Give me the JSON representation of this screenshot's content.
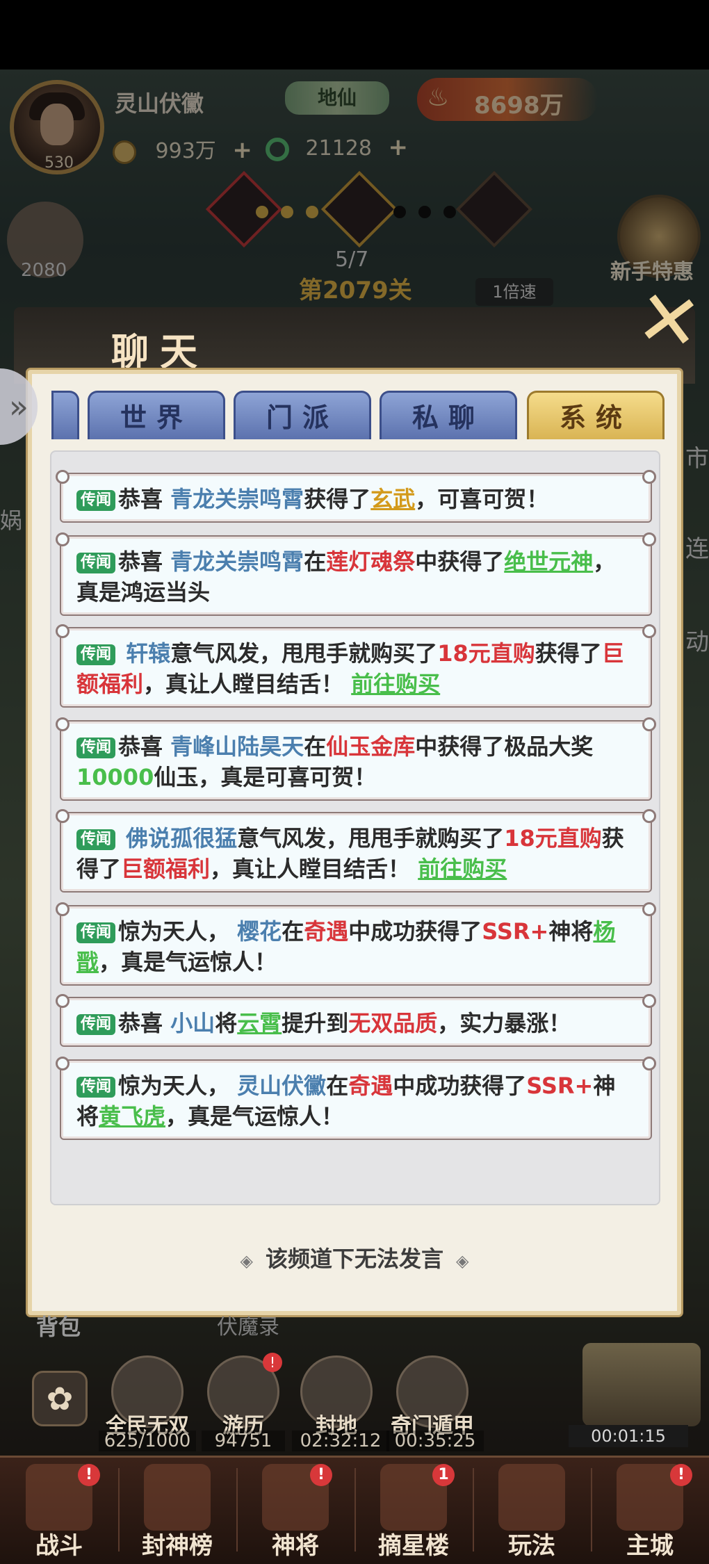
{
  "hud": {
    "player_name": "灵山伏黴",
    "player_level": "530",
    "rank": "地仙",
    "power": "8698万",
    "coins": "993万",
    "jade": "21128",
    "plus_symbol": "+",
    "stage_progress": "5/7",
    "stage_name": "第2079关",
    "speed": "1倍速",
    "left_badge_value": "2080",
    "newbie_offer": "新手特惠",
    "side_right_labels": [
      "市",
      "连",
      "动"
    ],
    "side_left_label": "娲"
  },
  "chat": {
    "title": "聊天",
    "close": "✕",
    "side_arrow": "»",
    "tabs": [
      {
        "label": "世界",
        "active": false
      },
      {
        "label": "门派",
        "active": false
      },
      {
        "label": "私聊",
        "active": false
      },
      {
        "label": "系统",
        "active": true
      }
    ],
    "tag_label": "传闻",
    "messages": [
      {
        "segments": [
          {
            "t": "恭喜 ",
            "c": ""
          },
          {
            "t": "青龙关崇鸣霄",
            "c": "c-blue"
          },
          {
            "t": "获得了",
            "c": ""
          },
          {
            "t": "玄武",
            "c": "c-gold u"
          },
          {
            "t": "，可喜可贺！",
            "c": ""
          }
        ]
      },
      {
        "segments": [
          {
            "t": "恭喜 ",
            "c": ""
          },
          {
            "t": "青龙关崇鸣霄",
            "c": "c-blue"
          },
          {
            "t": "在",
            "c": ""
          },
          {
            "t": "莲灯魂祭",
            "c": "c-red"
          },
          {
            "t": "中获得了",
            "c": ""
          },
          {
            "t": "绝世元神",
            "c": "c-green u"
          },
          {
            "t": "，真是鸿运当头",
            "c": ""
          }
        ]
      },
      {
        "segments": [
          {
            "t": " ",
            "c": ""
          },
          {
            "t": "轩辕",
            "c": "c-blue"
          },
          {
            "t": "意气风发，甩甩手就购买了",
            "c": ""
          },
          {
            "t": "18元直购",
            "c": "c-red"
          },
          {
            "t": "获得了",
            "c": ""
          },
          {
            "t": "巨额福利",
            "c": "c-red"
          },
          {
            "t": "，真让人瞠目结舌！ ",
            "c": ""
          },
          {
            "t": "前往购买",
            "c": "c-green u"
          }
        ]
      },
      {
        "segments": [
          {
            "t": "恭喜 ",
            "c": ""
          },
          {
            "t": "青峰山陆昊天",
            "c": "c-blue"
          },
          {
            "t": "在",
            "c": ""
          },
          {
            "t": "仙玉金库",
            "c": "c-red"
          },
          {
            "t": "中获得了极品大奖",
            "c": ""
          },
          {
            "t": "10000",
            "c": "c-green"
          },
          {
            "t": "仙玉，真是可喜可贺！",
            "c": ""
          }
        ]
      },
      {
        "segments": [
          {
            "t": " ",
            "c": ""
          },
          {
            "t": "佛说孤很猛",
            "c": "c-blue"
          },
          {
            "t": "意气风发，甩甩手就购买了",
            "c": ""
          },
          {
            "t": "18元直购",
            "c": "c-red"
          },
          {
            "t": "获得了",
            "c": ""
          },
          {
            "t": "巨额福利",
            "c": "c-red"
          },
          {
            "t": "，真让人瞠目结舌！ ",
            "c": ""
          },
          {
            "t": "前往购买",
            "c": "c-green u"
          }
        ]
      },
      {
        "segments": [
          {
            "t": "惊为天人， ",
            "c": ""
          },
          {
            "t": "樱花",
            "c": "c-blue"
          },
          {
            "t": "在",
            "c": ""
          },
          {
            "t": "奇遇",
            "c": "c-red"
          },
          {
            "t": "中成功获得了",
            "c": ""
          },
          {
            "t": "SSR+",
            "c": "c-red"
          },
          {
            "t": "神将",
            "c": ""
          },
          {
            "t": "杨戬",
            "c": "c-green u"
          },
          {
            "t": "，真是气运惊人！",
            "c": ""
          }
        ]
      },
      {
        "segments": [
          {
            "t": "恭喜 ",
            "c": ""
          },
          {
            "t": "小山",
            "c": "c-blue"
          },
          {
            "t": "将",
            "c": ""
          },
          {
            "t": "云霄",
            "c": "c-green u"
          },
          {
            "t": "提升到",
            "c": ""
          },
          {
            "t": "无双品质",
            "c": "c-red"
          },
          {
            "t": "，实力暴涨！",
            "c": ""
          }
        ]
      },
      {
        "segments": [
          {
            "t": "惊为天人， ",
            "c": ""
          },
          {
            "t": "灵山伏黴",
            "c": "c-blue"
          },
          {
            "t": "在",
            "c": ""
          },
          {
            "t": "奇遇",
            "c": "c-red"
          },
          {
            "t": "中成功获得了",
            "c": ""
          },
          {
            "t": "SSR+",
            "c": "c-red"
          },
          {
            "t": "神将",
            "c": ""
          },
          {
            "t": "黄飞虎",
            "c": "c-green u"
          },
          {
            "t": "，真是气运惊人！",
            "c": ""
          }
        ]
      }
    ],
    "footer_notice": "该频道下无法发言",
    "footer_deco": "◈"
  },
  "bottom": {
    "bag_label": "背包",
    "faded_label": "伏魔录",
    "features": [
      {
        "label": "全民无双",
        "stat": "625/1000",
        "badge": ""
      },
      {
        "label": "游历",
        "stat": "94751",
        "badge": "!"
      },
      {
        "label": "封地",
        "stat": "02:32:12",
        "badge": ""
      },
      {
        "label": "奇门遁甲",
        "stat": "00:35:25",
        "badge": ""
      }
    ],
    "flower_icon": "✿",
    "treasure_timer": "00:01:15",
    "nav": [
      {
        "label": "战斗",
        "badge": "!"
      },
      {
        "label": "封神榜",
        "badge": ""
      },
      {
        "label": "神将",
        "badge": "!"
      },
      {
        "label": "摘星楼",
        "badge": "1"
      },
      {
        "label": "玩法",
        "badge": ""
      },
      {
        "label": "主城",
        "badge": "!"
      }
    ]
  },
  "colors": {
    "tag_green": "#2f9c5a",
    "name_blue": "#4b7fae",
    "highlight_red": "#d8353a",
    "link_green": "#49be4b",
    "reward_gold": "#d39a1b",
    "active_tab": "#d9b454",
    "inactive_tab": "#5c72ae"
  }
}
